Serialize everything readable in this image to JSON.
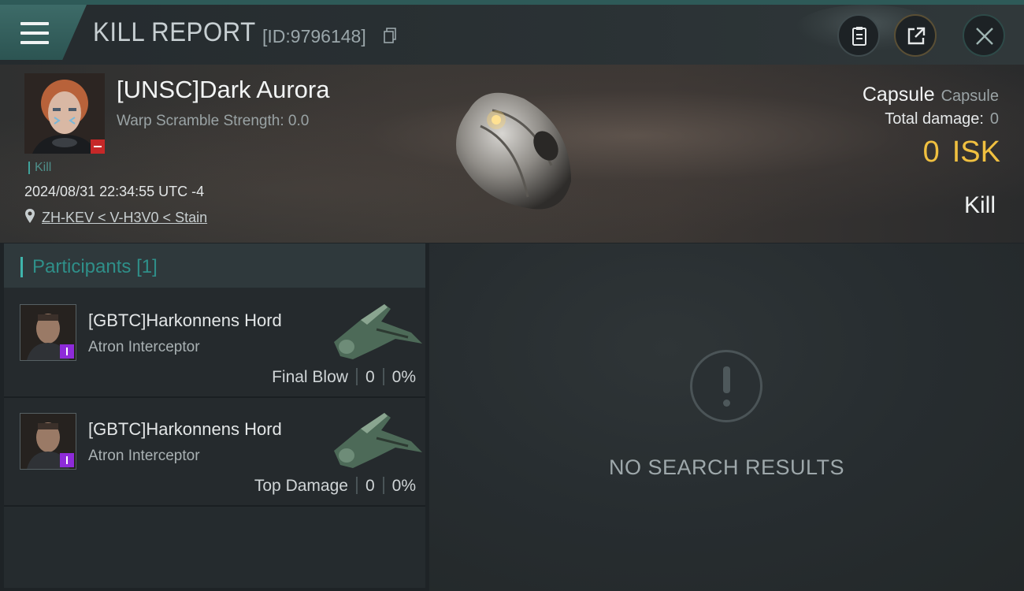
{
  "header": {
    "title": "KILL REPORT",
    "report_id": "[ID:9796148]"
  },
  "victim": {
    "name": "[UNSC]Dark Aurora",
    "warp_scramble": "Warp Scramble Strength: 0.0",
    "kill_tag": "Kill",
    "datetime": "2024/08/31 22:34:55 UTC -4",
    "location": "ZH-KEV < V-H3V0 < Stain",
    "ship_name": "Capsule",
    "ship_type": "Capsule",
    "total_damage_label": "Total damage:",
    "total_damage_value": "0",
    "isk_value": "0",
    "isk_unit": "ISK",
    "result_label": "Kill"
  },
  "participants": {
    "title": "Participants",
    "count": "[1]",
    "items": [
      {
        "name": "[GBTC]Harkonnens Hord",
        "ship": "Atron Interceptor",
        "role": "Final Blow",
        "damage": "0",
        "percent": "0%"
      },
      {
        "name": "[GBTC]Harkonnens Hord",
        "ship": "Atron Interceptor",
        "role": "Top Damage",
        "damage": "0",
        "percent": "0%"
      }
    ]
  },
  "right_pane": {
    "empty_message": "NO SEARCH RESULTS"
  },
  "colors": {
    "accent_teal": "#3fb5ac",
    "isk_gold": "#f0c040",
    "badge_purple": "#8e2bd9",
    "badge_red": "#c62828"
  },
  "icons": [
    "menu-icon",
    "copy-icon",
    "clipboard-icon",
    "share-icon",
    "close-icon",
    "map-pin-icon",
    "alert-icon"
  ]
}
